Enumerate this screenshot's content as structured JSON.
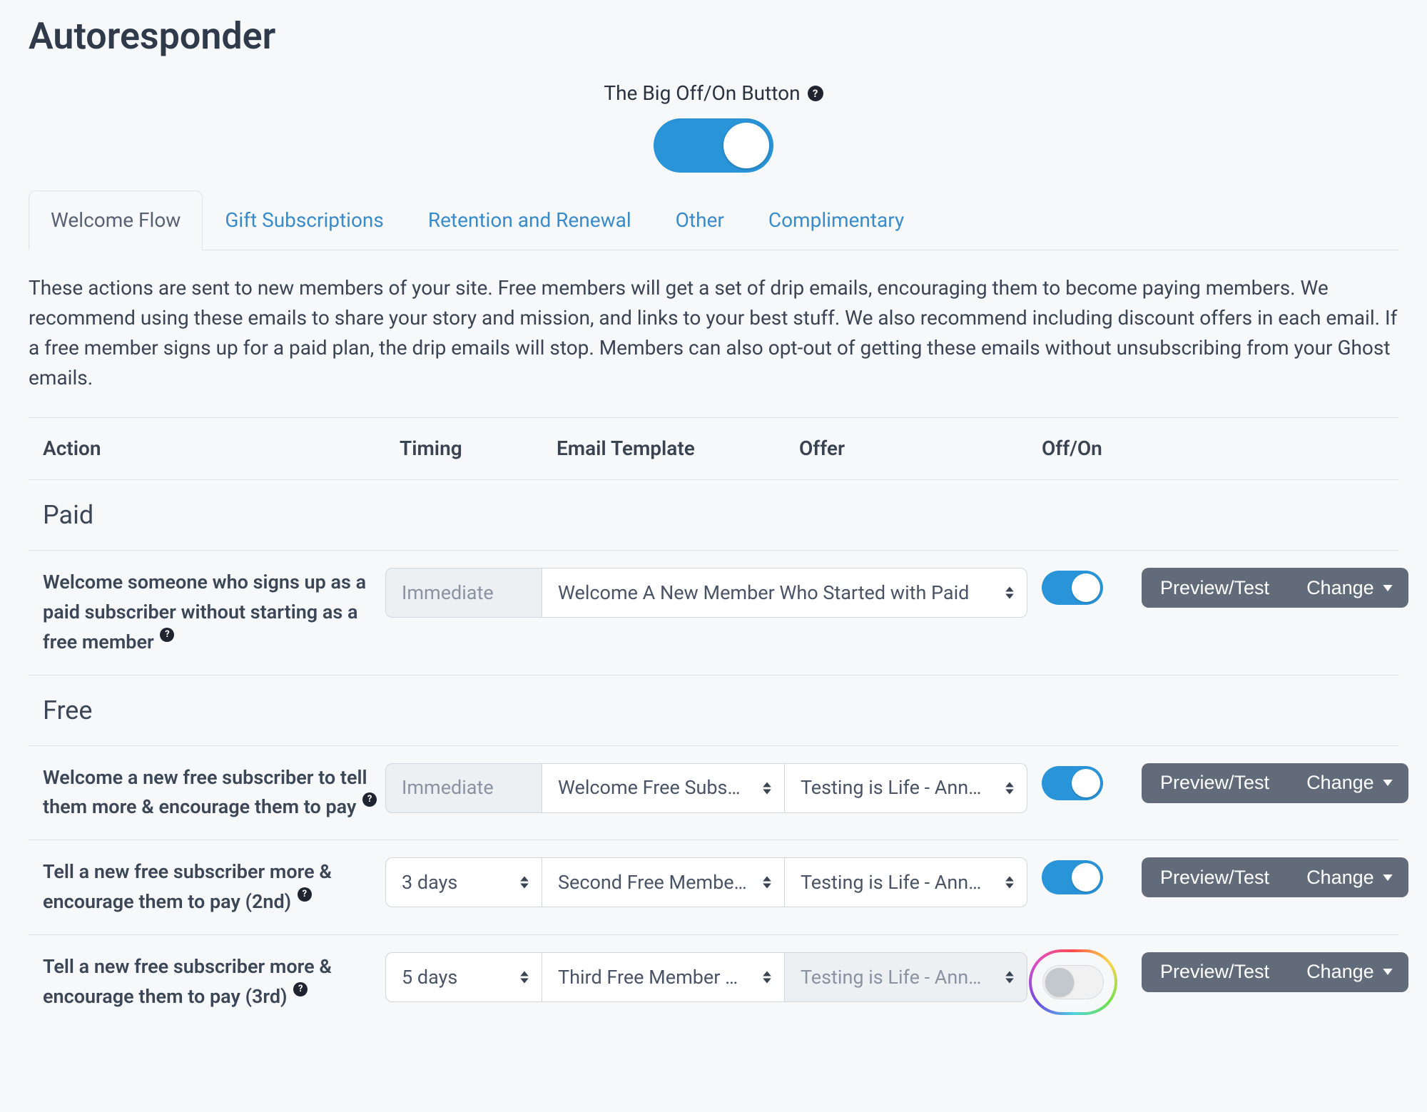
{
  "page": {
    "title": "Autoresponder",
    "bigSwitchLabel": "The Big Off/On Button",
    "intro": "These actions are sent to new members of your site. Free members will get a set of drip emails, encouraging them to become paying members. We recommend using these emails to share your story and mission, and links to your best stuff. We also recommend including discount offers in each email. If a free member signs up for a paid plan, the drip emails will stop. Members can also opt-out of getting these emails without unsubscribing from your Ghost emails."
  },
  "tabs": [
    {
      "label": "Welcome Flow",
      "active": true
    },
    {
      "label": "Gift Subscriptions",
      "active": false
    },
    {
      "label": "Retention and Renewal",
      "active": false
    },
    {
      "label": "Other",
      "active": false
    },
    {
      "label": "Complimentary",
      "active": false
    }
  ],
  "columns": {
    "action": "Action",
    "timing": "Timing",
    "template": "Email Template",
    "offer": "Offer",
    "offon": "Off/On"
  },
  "sections": {
    "paid": "Paid",
    "free": "Free"
  },
  "buttons": {
    "preview": "Preview/Test",
    "change": "Change"
  },
  "rows": [
    {
      "id": "paid-welcome",
      "section": "paid",
      "action": "Welcome someone who signs up as a paid subscriber without starting as a free member",
      "help": true,
      "timing": "Immediate",
      "timingDisabled": true,
      "template": "Welcome A New Member Who Started with Paid",
      "templateWide": true,
      "offer": "",
      "offerHidden": true,
      "on": true
    },
    {
      "id": "free-welcome",
      "section": "free",
      "action": "Welcome a new free subscriber to tell them more & encourage them to pay",
      "help": true,
      "timing": "Immediate",
      "timingDisabled": true,
      "template": "Welcome Free Subscriber",
      "templateWide": false,
      "offer": "Testing is Life - Annual",
      "on": true
    },
    {
      "id": "free-2nd",
      "section": "free",
      "action": "Tell a new free subscriber more & encourage them to pay (2nd)",
      "help": true,
      "timing": "3 days",
      "timingDisabled": false,
      "template": "Second Free Member Email",
      "templateWide": false,
      "offer": "Testing is Life - Annual",
      "on": true
    },
    {
      "id": "free-3rd",
      "section": "free",
      "action": "Tell a new free subscriber more & encourage them to pay (3rd)",
      "help": true,
      "timing": "5 days",
      "timingDisabled": false,
      "template": "Third Free Member Email",
      "templateWide": false,
      "offer": "Testing is Life - Annual",
      "offerDisabled": true,
      "on": false,
      "highlight": true
    }
  ]
}
